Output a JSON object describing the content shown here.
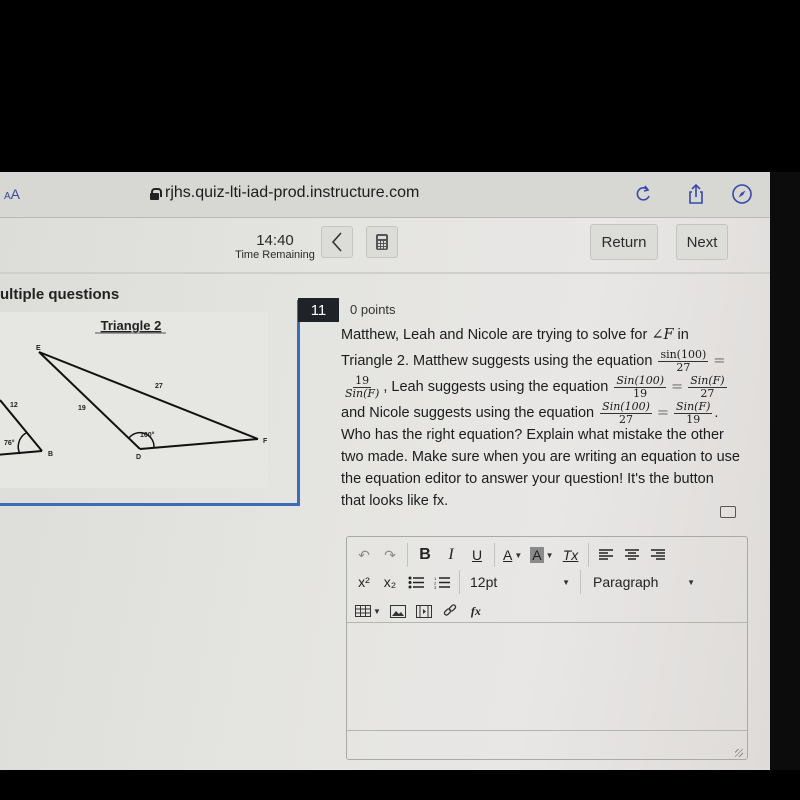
{
  "browser": {
    "text_size_label": "AA",
    "url": "rjhs.quiz-lti-iad-prod.instructure.com",
    "icons": [
      "lock-icon",
      "reload-icon",
      "share-icon",
      "compass-icon"
    ]
  },
  "quiz_header": {
    "time_value": "14:40",
    "time_label": "Time Remaining",
    "prev_label": "<",
    "return_label": "Return",
    "next_label": "Next"
  },
  "left_pane": {
    "section_title": "ultiple questions",
    "figure": {
      "title": "Triangle 2",
      "partial_triangle": {
        "side_label": "12",
        "angle_label": "76°",
        "vertex_label": "B"
      },
      "triangle2": {
        "vertices": [
          "E",
          "D",
          "F"
        ],
        "side_ED": "19",
        "side_EF": "27",
        "angle_D": "100°"
      }
    }
  },
  "question": {
    "number": "11",
    "points": "0 points",
    "intro": "Matthew, Leah and Nicole are trying to solve for",
    "angle_symbol": "∠F",
    "in_word": " in",
    "line2": "Triangle 2. Matthew suggests using the equation",
    "matthew_eq": {
      "left_num": "sin(100)",
      "left_den": "27",
      "right_num": "19",
      "right_den": "Sin(F)"
    },
    "leah_text": ", Leah suggests using the equation",
    "leah_eq": {
      "left_num": "Sin(100)",
      "left_den": "19",
      "right_num": "Sin(F)",
      "right_den": "27"
    },
    "nicole_text": "and Nicole suggests using the equation",
    "nicole_eq": {
      "left_num": "Sin(100)",
      "left_den": "27",
      "right_num": "Sin(F)",
      "right_den": "19"
    },
    "equals": "=",
    "period": ".",
    "closing": "Who has the right equation? Explain what mistake the other two made. Make sure when you are writing an equation to use the equation editor to answer your question! It's the button that looks like fx."
  },
  "editor": {
    "toolbar": {
      "undo": "↶",
      "redo": "↷",
      "bold": "B",
      "italic": "I",
      "underline": "U",
      "text_color": "A",
      "bg_color": "A",
      "clear_format": "Tx",
      "superscript": "x²",
      "subscript": "x₂",
      "font_size": "12pt",
      "block_format": "Paragraph",
      "equation": "fx"
    },
    "content": ""
  }
}
